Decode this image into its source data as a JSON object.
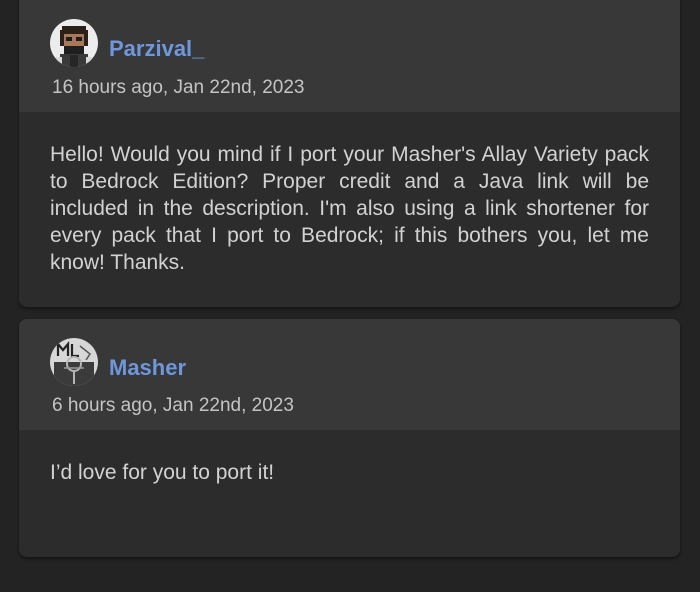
{
  "comments": [
    {
      "username": "Parzival_",
      "timestamp": "16 hours ago, Jan 22nd, 2023",
      "body": "Hello! Would you mind if I port your Masher's Allay Variety pack to Bedrock Edition? Proper credit and a Java link will be included in the description. I'm also using a link shortener for every pack that I port to Bedrock; if this bothers you, let me know! Thanks."
    },
    {
      "username": "Masher",
      "timestamp": "6 hours ago, Jan 22nd, 2023",
      "body": "I’d love for you to port it!"
    }
  ],
  "colors": {
    "page_background": "#232323",
    "card_background": "#2c2c2c",
    "header_background": "#383838",
    "username": "#6f97dc",
    "text": "#d2d2d2"
  }
}
